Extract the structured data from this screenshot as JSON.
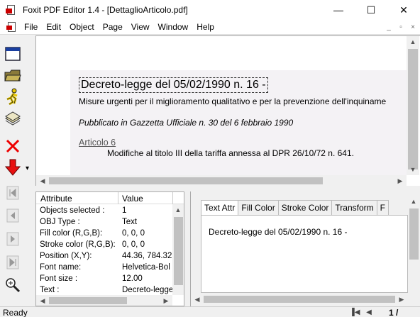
{
  "window": {
    "title": "Foxit PDF Editor 1.4  -  [DettaglioArticolo.pdf]",
    "minimize": "—",
    "maximize": "☐",
    "close": "✕"
  },
  "menu": {
    "items": [
      "File",
      "Edit",
      "Object",
      "Page",
      "View",
      "Window",
      "Help"
    ],
    "mdi_minimize": "_",
    "mdi_restore": "▫",
    "mdi_close": "×"
  },
  "toolbar": {
    "icons": [
      "window-icon",
      "open-folder-icon",
      "run-icon",
      "stack-icon",
      "delete-icon",
      "down-arrow-icon",
      "first-page-icon",
      "prev-page-icon",
      "next-page-icon",
      "last-page-icon",
      "zoom-icon"
    ],
    "dropdown": "▾"
  },
  "document": {
    "title": "Decreto-legge del 05/02/1990 n. 16 -",
    "line1": "Misure urgenti per il miglioramento qualitativo e per la prevenzione dell'inquiname",
    "line2": "Pubblicato in Gazzetta Ufficiale n. 30 del 6 febbraio 1990",
    "article": "Articolo 6",
    "line3": "Modifiche al titolo III della tariffa annessa al DPR 26/10/72 n. 641."
  },
  "attributes": {
    "headers": {
      "attribute": "Attribute",
      "value": "Value"
    },
    "rows": [
      {
        "key": "Objects selected :",
        "value": "1"
      },
      {
        "key": "OBJ Type :",
        "value": "Text"
      },
      {
        "key": "Fill color (R,G,B):",
        "value": "0, 0, 0"
      },
      {
        "key": "Stroke color (R,G,B):",
        "value": "0, 0, 0"
      },
      {
        "key": "Position (X,Y):",
        "value": "44.36, 784.32"
      },
      {
        "key": "Font name:",
        "value": "Helvetica-Bol"
      },
      {
        "key": "Font size :",
        "value": "12.00"
      },
      {
        "key": "Text :",
        "value": "Decreto-legge"
      }
    ]
  },
  "text_panel": {
    "tabs": [
      "Text Attr",
      "Fill Color",
      "Stroke Color",
      "Transform",
      "F"
    ],
    "content": "Decreto-legge del 05/02/1990 n. 16 -"
  },
  "status": {
    "text": "Ready",
    "page": "1 /"
  }
}
